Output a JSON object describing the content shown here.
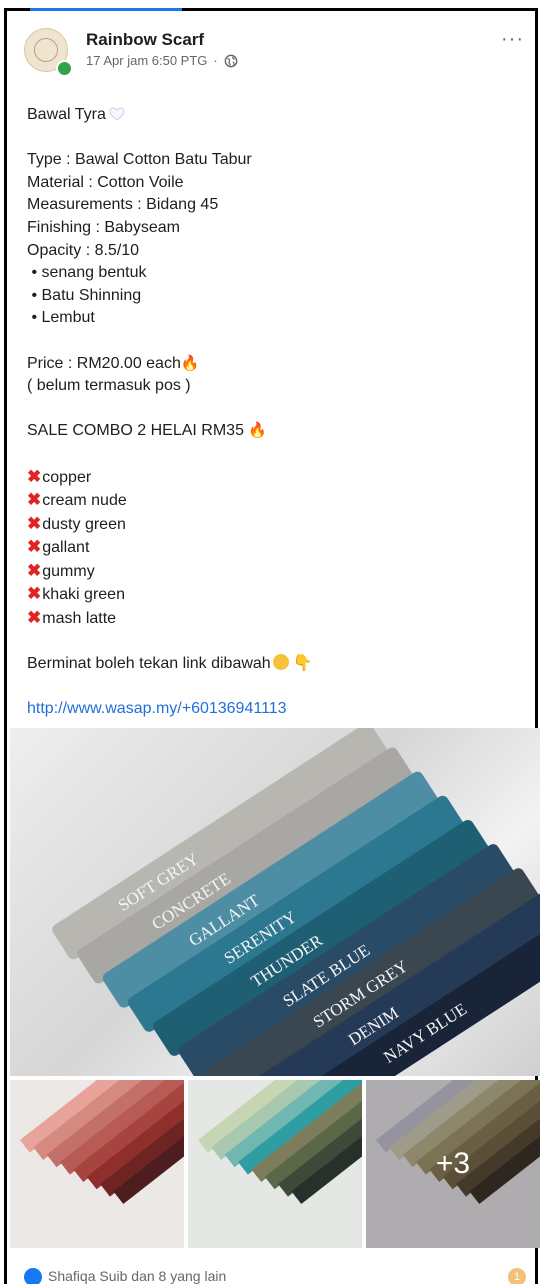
{
  "post": {
    "page_name": "Rainbow Scarf",
    "timestamp": "17 Apr jam 6:50 PTG",
    "dot": "·",
    "more_label": "···",
    "title": "Bawal Tyra",
    "lines": [
      "Type : Bawal Cotton Batu Tabur",
      "Material : Cotton Voile",
      "Measurements : Bidang 45",
      "Finishing : Babyseam",
      "Opacity : 8.5/10",
      " • senang bentuk",
      " • Batu Shinning",
      " • Lembut"
    ],
    "price": "Price : RM20.00 each",
    "price_note": "( belum termasuk pos )",
    "sale": "SALE COMBO 2 HELAI RM35 ",
    "sold_out": [
      "copper",
      "cream nude",
      "dusty green",
      "gallant",
      "gummy",
      "khaki green",
      "mash latte"
    ],
    "cta": "Berminat boleh tekan link dibawah",
    "link": "http://www.wasap.my/+60136941113"
  },
  "media": {
    "hero_labels": [
      "SOFT GREY",
      "CONCRETE",
      "GALLANT",
      "SERENITY",
      "THUNDER",
      "SLATE BLUE",
      "STORM GREY",
      "DENIM",
      "NAVY BLUE"
    ],
    "more_count": "+3"
  },
  "footer": {
    "reactions": "Shafiqa Suib dan 8 yang lain",
    "comments": "1"
  }
}
